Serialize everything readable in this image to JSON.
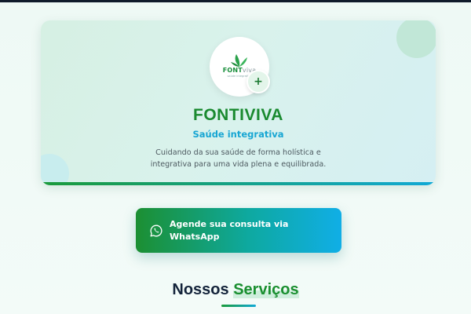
{
  "hero": {
    "logo": {
      "wordmark_part1": "FONT",
      "wordmark_part2": "viva",
      "wordmark_sub": "saúde integrativa"
    },
    "plus_badge": "+",
    "brand_name": "FONTIVIVA",
    "tagline": "Saúde integrativa",
    "description": "Cuidando da sua saúde de forma holística e integrativa para uma vida plena e equilibrada."
  },
  "cta": {
    "icon": "whatsapp-icon",
    "label": "Agende sua consulta via WhatsApp"
  },
  "services": {
    "title_part1": "Nossos",
    "title_part2": "Serviços"
  },
  "colors": {
    "brand_green": "#1a8a30",
    "brand_blue": "#18a6d3",
    "heading_dark": "#13233a"
  }
}
